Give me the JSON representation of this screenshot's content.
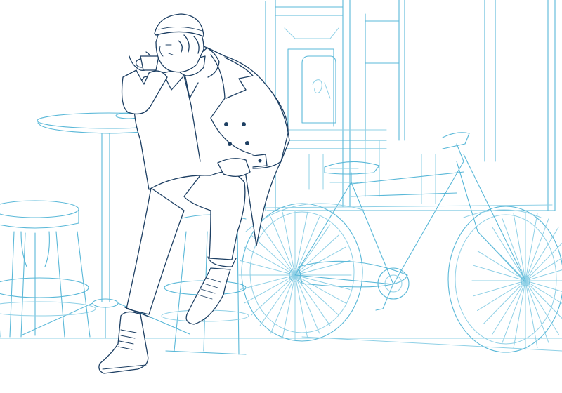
{
  "scene": {
    "style": "line-art sketch",
    "palette": {
      "background": "#ffffff",
      "sketch_blue": "#5ab8d8",
      "sketch_blue_light": "#8fd0e6",
      "figure_ink": "#1d3f63"
    },
    "elements": [
      "storefront",
      "cafe-table",
      "bar-stool-left",
      "bar-stool-right",
      "bicycle",
      "man-drinking-coffee"
    ]
  }
}
